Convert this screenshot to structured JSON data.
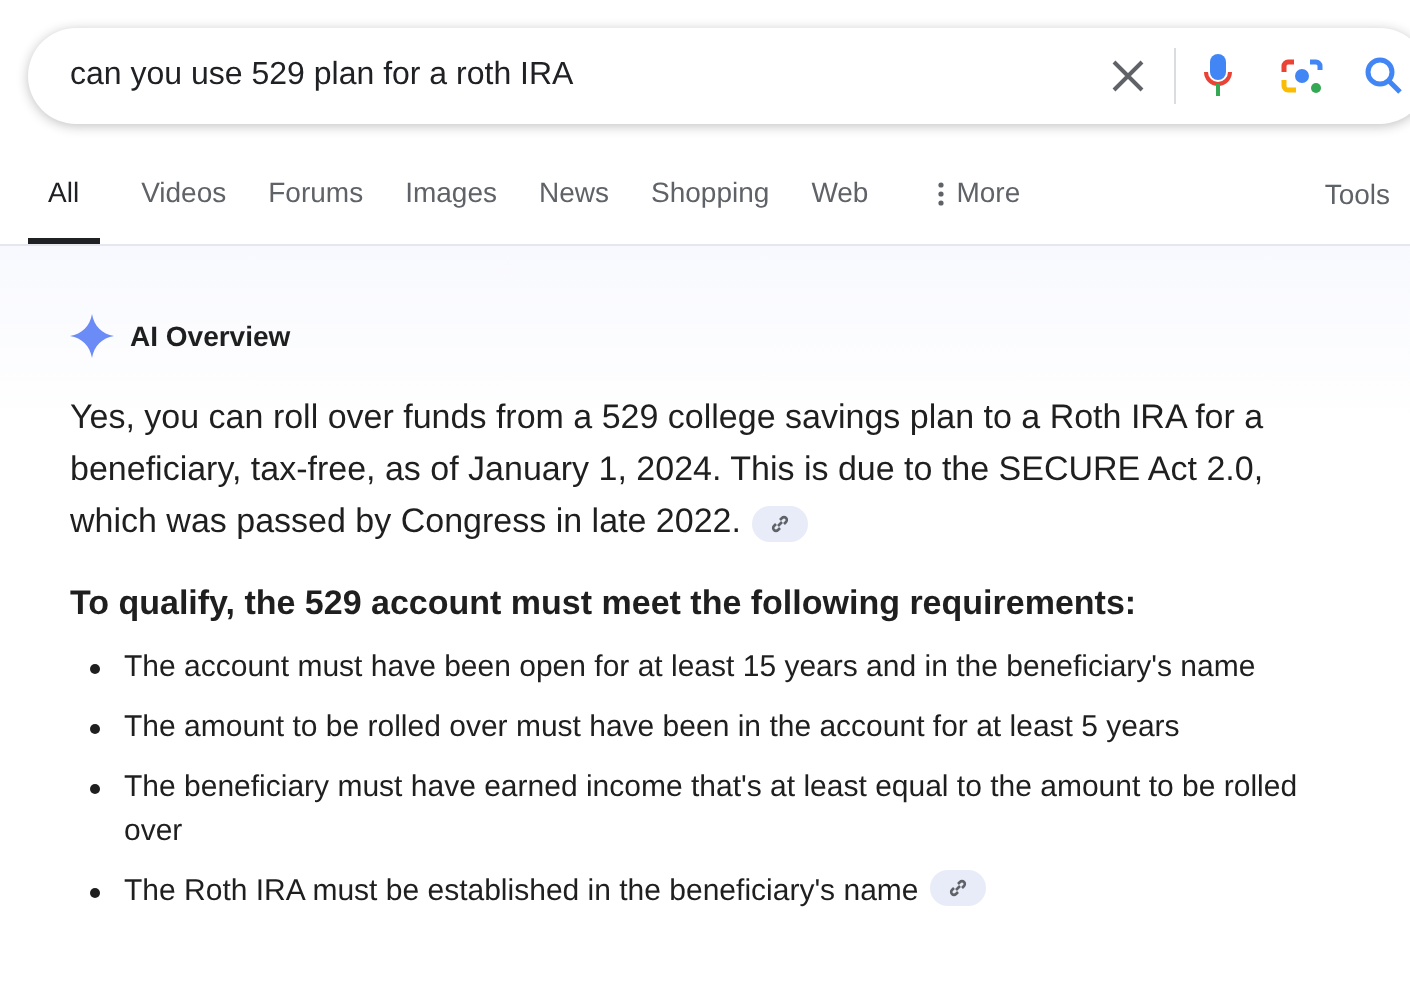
{
  "search": {
    "value": "can you use 529 plan for a roth IRA"
  },
  "tabs": [
    {
      "label": "All",
      "selected": true
    },
    {
      "label": "Videos",
      "selected": false
    },
    {
      "label": "Forums",
      "selected": false
    },
    {
      "label": "Images",
      "selected": false
    },
    {
      "label": "News",
      "selected": false
    },
    {
      "label": "Shopping",
      "selected": false
    },
    {
      "label": "Web",
      "selected": false
    },
    {
      "label": "More",
      "selected": false,
      "kind": "more"
    }
  ],
  "tools": "Tools",
  "ai_overview": {
    "title": "AI Overview",
    "summary": {
      "text": "Yes, you can roll over funds from a 529 college savings plan to a Roth IRA for a beneficiary, tax-free, as of January 1, 2024. This is due to the SECURE Act 2.0, which was passed by Congress in late 2022.",
      "source_link": true
    },
    "heading": "To qualify, the 529 account must meet the following requirements:",
    "requirements": [
      {
        "text": "The account must have been open for at least 15 years and in the beneficiary's name",
        "source_link": false
      },
      {
        "text": "The amount to be rolled over must have been in the account for at least 5 years",
        "source_link": false
      },
      {
        "text": "The beneficiary must have earned income that's at least equal to the amount to be rolled over",
        "source_link": false
      },
      {
        "text": "The Roth IRA must be established in the beneficiary's name",
        "source_link": true
      }
    ]
  }
}
